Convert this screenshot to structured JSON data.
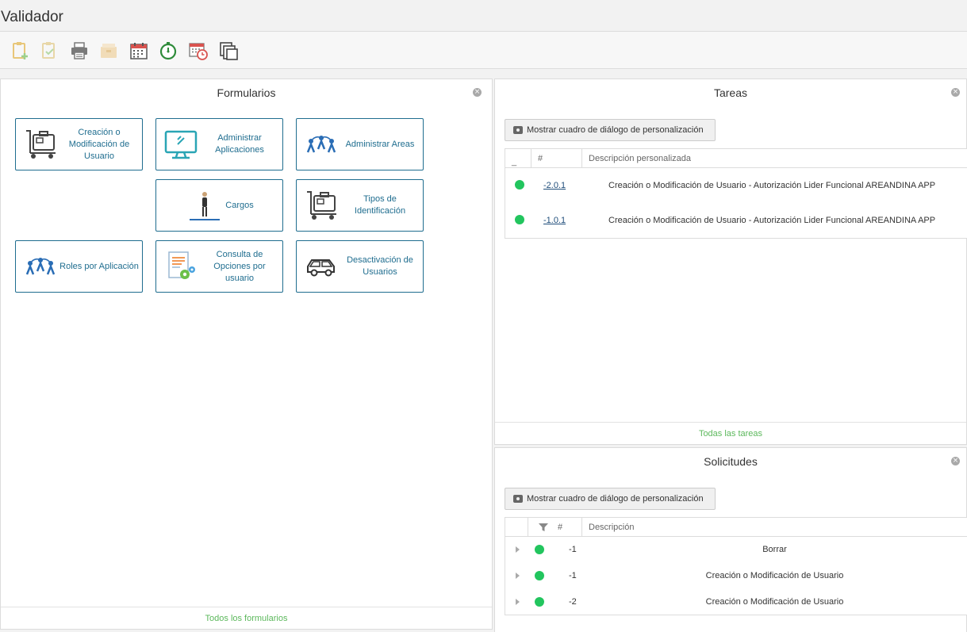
{
  "app": {
    "title": "Validador"
  },
  "toolbar": {
    "buttons": [
      {
        "icon": "clipboard-add-icon"
      },
      {
        "icon": "clipboard-check-icon"
      },
      {
        "icon": "printer-icon"
      },
      {
        "icon": "archive-icon"
      },
      {
        "icon": "calendar-icon"
      },
      {
        "icon": "timer-icon"
      },
      {
        "icon": "calendar-clock-icon"
      },
      {
        "icon": "copy-icon"
      }
    ]
  },
  "formularios": {
    "title": "Formularios",
    "close": "×",
    "footer": "Todos los formularios",
    "tiles": [
      {
        "label": "Creación o Modificación de Usuario",
        "icon": "luggage-cart-icon"
      },
      {
        "label": "Administrar Aplicaciones",
        "icon": "monitor-icon"
      },
      {
        "label": "Administrar Areas",
        "icon": "people-network-icon"
      },
      {
        "label": "Cargos",
        "icon": "person-icon"
      },
      {
        "label": "Tipos de Identificación",
        "icon": "luggage-cart-icon"
      },
      {
        "label": "Roles por Aplicación",
        "icon": "people-network-icon"
      },
      {
        "label": "Consulta de Opciones por usuario",
        "icon": "document-gears-icon"
      },
      {
        "label": "Desactivación de Usuarios",
        "icon": "car-icon"
      }
    ]
  },
  "tareas": {
    "title": "Tareas",
    "close": "×",
    "dialog_button": "Mostrar cuadro de diálogo de personalización",
    "columns": [
      "_",
      "#",
      "Descripción personalizada"
    ],
    "rows": [
      {
        "num": "-2.0.1",
        "desc": "Creación o Modificación de Usuario - Autorización Lider Funcional AREANDINA APP",
        "status_color": "#22c55e"
      },
      {
        "num": "-1.0.1",
        "desc": "Creación o Modificación de Usuario - Autorización Lider Funcional AREANDINA APP",
        "status_color": "#22c55e"
      }
    ],
    "footer": "Todas las tareas"
  },
  "solicitudes": {
    "title": "Solicitudes",
    "close": "×",
    "dialog_button": "Mostrar cuadro de diálogo de personalización",
    "columns": [
      "#",
      "Descripción"
    ],
    "rows": [
      {
        "num": "-1",
        "desc": "Borrar",
        "status_color": "#22c55e"
      },
      {
        "num": "-1",
        "desc": "Creación o Modificación de Usuario",
        "status_color": "#22c55e"
      },
      {
        "num": "-2",
        "desc": "Creación o Modificación de Usuario",
        "status_color": "#22c55e"
      }
    ]
  }
}
